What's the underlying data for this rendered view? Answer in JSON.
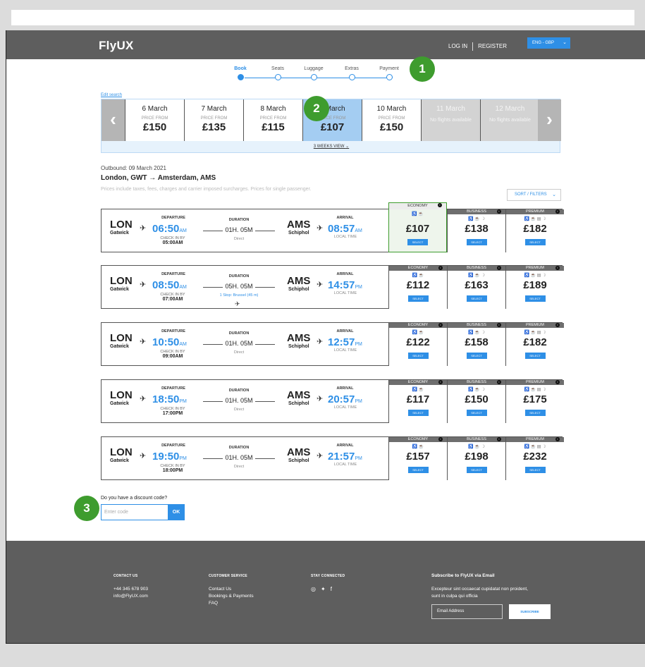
{
  "header": {
    "logo": "FlyUX",
    "login": "LOG IN",
    "register": "REGISTER",
    "language": "ENG - GBP"
  },
  "steps": [
    "Book",
    "Seats",
    "Luggage",
    "Extras",
    "Payment"
  ],
  "badges": [
    "1",
    "2",
    "3"
  ],
  "edit_search": "Edit search",
  "dates": [
    {
      "date": "6 March",
      "label": "PRICE FROM",
      "price": "£150"
    },
    {
      "date": "7 March",
      "label": "PRICE FROM",
      "price": "£135"
    },
    {
      "date": "8 March",
      "label": "PRICE FROM",
      "price": "£115"
    },
    {
      "date": "9 March",
      "label": "PRICE FROM",
      "price": "£107"
    },
    {
      "date": "10 March",
      "label": "PRICE FROM",
      "price": "£150"
    },
    {
      "date": "11 March",
      "label": "No flights available",
      "price": ""
    },
    {
      "date": "12 March",
      "label": "No flights available",
      "price": ""
    }
  ],
  "weeks_view": "3 WEEKS VIEW",
  "outbound": "Outbound: 09 March 2021",
  "route": "London, GWT → Amsterdam, AMS",
  "disclaimer": "Prices include taxes, fees, charges and carrier imposed surcharges. Prices for single passenger.",
  "sort_filters": "SORT / FILTERS",
  "labels": {
    "departure": "DEPARTURE",
    "duration": "DURATION",
    "arrival": "ARRIVAL",
    "check_in": "CHECK IN BY",
    "local_time": "LOCAL TIME",
    "select": "SELECT",
    "economy": "ECONOMY",
    "business": "BUSINESS",
    "premium": "PREMIUM",
    "from_code": "LON",
    "from_airport": "Gatwick",
    "to_code": "AMS",
    "to_airport": "Schiphol",
    "duration_value": "01H. 05M"
  },
  "flights": [
    {
      "dep": "06:50",
      "dep_ampm": "AM",
      "checkin": "05:00AM",
      "duration": "01H. 05M",
      "stops": "Direct",
      "arr": "08:57",
      "arr_ampm": "AM",
      "economy": "£107",
      "business": "£138",
      "premium": "£182"
    },
    {
      "dep": "08:50",
      "dep_ampm": "AM",
      "checkin": "07:00AM",
      "duration": "05H. 05M",
      "stops": "1 Stop: Brussel (45 m)",
      "arr": "14:57",
      "arr_ampm": "PM",
      "economy": "£112",
      "business": "£163",
      "premium": "£189"
    },
    {
      "dep": "10:50",
      "dep_ampm": "AM",
      "checkin": "09:00AM",
      "duration": "01H. 05M",
      "stops": "Direct",
      "arr": "12:57",
      "arr_ampm": "PM",
      "economy": "£122",
      "business": "£158",
      "premium": "£182"
    },
    {
      "dep": "18:50",
      "dep_ampm": "PM",
      "checkin": "17:00PM",
      "duration": "01H. 05M",
      "stops": "Direct",
      "arr": "20:57",
      "arr_ampm": "PM",
      "economy": "£117",
      "business": "£150",
      "premium": "£175"
    },
    {
      "dep": "19:50",
      "dep_ampm": "PM",
      "checkin": "18:00PM",
      "duration": "01H. 05M",
      "stops": "Direct",
      "arr": "21:57",
      "arr_ampm": "PM",
      "economy": "£157",
      "business": "£198",
      "premium": "£232"
    }
  ],
  "discount": {
    "label": "Do you have a discount code?",
    "placeholder": "Enter code",
    "ok": "OK"
  },
  "footer": {
    "contact_heading": "CONTACT US",
    "phone": "+44 345 678 903",
    "email": "info@FlyUX.com",
    "service_heading": "CUSTOMER SERVICE",
    "service_links": [
      "Contact Us",
      "Bookings & Payments",
      "FAQ"
    ],
    "stay_heading": "STAY CONNECTED",
    "subscribe_title": "Subscribe to FlyUX via Email",
    "subscribe_text": "Excepteur sint occaecat cupidatat non proident, sunt in culpa qui officia",
    "email_placeholder": "Email Address",
    "subscribe_button": "SUBSCRIBE"
  }
}
